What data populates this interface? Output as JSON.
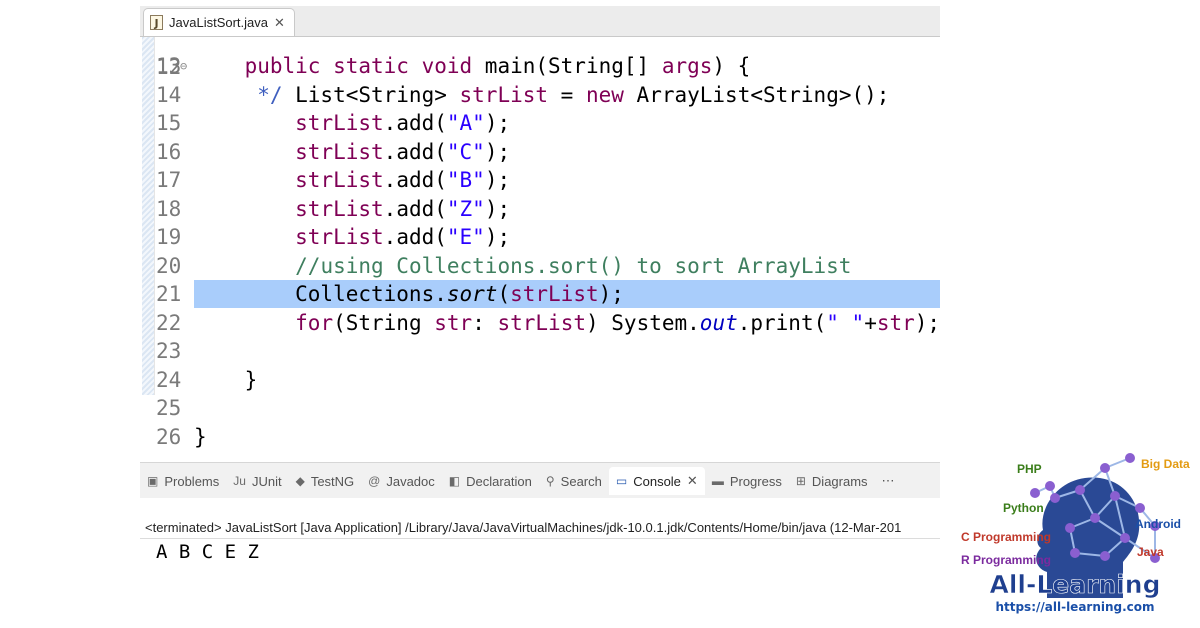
{
  "editor": {
    "tab": {
      "file_name": "JavaListSort.java",
      "close": "✕"
    },
    "top_fragment": {
      "line_number": "12",
      "code": "*/"
    },
    "lines": [
      {
        "n": "13",
        "fold": "⊖",
        "tokens": [
          {
            "t": "    "
          },
          {
            "t": "public static void",
            "c": "kw"
          },
          {
            "t": " main(String[] "
          },
          {
            "t": "args",
            "c": "kw"
          },
          {
            "t": ") {"
          }
        ]
      },
      {
        "n": "14",
        "tokens": [
          {
            "t": "        List<String> "
          },
          {
            "t": "strList",
            "c": "kw"
          },
          {
            "t": " = "
          },
          {
            "t": "new",
            "c": "kw"
          },
          {
            "t": " ArrayList<String>();"
          }
        ]
      },
      {
        "n": "15",
        "tokens": [
          {
            "t": "        "
          },
          {
            "t": "strList",
            "c": "kw"
          },
          {
            "t": ".add("
          },
          {
            "t": "\"A\"",
            "c": "str"
          },
          {
            "t": ");"
          }
        ]
      },
      {
        "n": "16",
        "tokens": [
          {
            "t": "        "
          },
          {
            "t": "strList",
            "c": "kw"
          },
          {
            "t": ".add("
          },
          {
            "t": "\"C\"",
            "c": "str"
          },
          {
            "t": ");"
          }
        ]
      },
      {
        "n": "17",
        "tokens": [
          {
            "t": "        "
          },
          {
            "t": "strList",
            "c": "kw"
          },
          {
            "t": ".add("
          },
          {
            "t": "\"B\"",
            "c": "str"
          },
          {
            "t": ");"
          }
        ]
      },
      {
        "n": "18",
        "tokens": [
          {
            "t": "        "
          },
          {
            "t": "strList",
            "c": "kw"
          },
          {
            "t": ".add("
          },
          {
            "t": "\"Z\"",
            "c": "str"
          },
          {
            "t": ");"
          }
        ]
      },
      {
        "n": "19",
        "tokens": [
          {
            "t": "        "
          },
          {
            "t": "strList",
            "c": "kw"
          },
          {
            "t": ".add("
          },
          {
            "t": "\"E\"",
            "c": "str"
          },
          {
            "t": ");"
          }
        ]
      },
      {
        "n": "20",
        "tokens": [
          {
            "t": "        "
          },
          {
            "t": "//using Collections.sort() to sort ArrayList",
            "c": "cm"
          }
        ]
      },
      {
        "n": "21",
        "tokens": [
          {
            "t": "        Collections."
          },
          {
            "t": "sort",
            "c": "it"
          },
          {
            "t": "("
          },
          {
            "t": "strList",
            "c": "kw"
          },
          {
            "t": ");"
          }
        ]
      },
      {
        "n": "22",
        "tokens": [
          {
            "t": "        "
          },
          {
            "t": "for",
            "c": "kw"
          },
          {
            "t": "(String "
          },
          {
            "t": "str",
            "c": "kw"
          },
          {
            "t": ": "
          },
          {
            "t": "strList",
            "c": "kw"
          },
          {
            "t": ") System."
          },
          {
            "t": "out",
            "c": "fld"
          },
          {
            "t": ".print("
          },
          {
            "t": "\" \"",
            "c": "str"
          },
          {
            "t": "+"
          },
          {
            "t": "str",
            "c": "kw"
          },
          {
            "t": ");"
          }
        ]
      },
      {
        "n": "23",
        "tokens": []
      },
      {
        "n": "24",
        "tokens": [
          {
            "t": "    }"
          }
        ]
      },
      {
        "n": "25",
        "tokens": []
      },
      {
        "n": "26",
        "tokens": [
          {
            "t": "}"
          }
        ]
      }
    ]
  },
  "views": {
    "tabs": [
      {
        "label": "Problems",
        "icon": "problems-icon",
        "glyph": "▣"
      },
      {
        "label": "JUnit",
        "icon": "junit-icon",
        "glyph": "Ju"
      },
      {
        "label": "TestNG",
        "icon": "testng-icon",
        "glyph": "◆"
      },
      {
        "label": "Javadoc",
        "icon": "javadoc-icon",
        "glyph": "@"
      },
      {
        "label": "Declaration",
        "icon": "declaration-icon",
        "glyph": "◧"
      },
      {
        "label": "Search",
        "icon": "search-icon",
        "glyph": "⚲"
      },
      {
        "label": "Console",
        "icon": "console-icon",
        "glyph": "▭",
        "active": true
      },
      {
        "label": "Progress",
        "icon": "progress-icon",
        "glyph": "▬"
      },
      {
        "label": "Diagrams",
        "icon": "diagrams-icon",
        "glyph": "⊞"
      }
    ],
    "console_close": "✕",
    "overflow_icon": "⋯"
  },
  "console": {
    "header": "<terminated> JavaListSort [Java Application] /Library/Java/JavaVirtualMachines/jdk-10.0.1.jdk/Contents/Home/bin/java (12-Mar-201",
    "output": "A B C E Z"
  },
  "logo": {
    "tags": [
      {
        "text": "PHP",
        "color": "#3a7d1a"
      },
      {
        "text": "Big Data",
        "color": "#e39b12"
      },
      {
        "text": "Python",
        "color": "#3a7d1a"
      },
      {
        "text": "Android",
        "color": "#1a4fa8"
      },
      {
        "text": "C Programming",
        "color": "#c0392b"
      },
      {
        "text": "Java",
        "color": "#c0392b"
      },
      {
        "text": "R Programming",
        "color": "#7b2a9e"
      }
    ],
    "brand": "All-Learning",
    "url": "https://all-learning.com",
    "colors": {
      "head": "#1f3f8f",
      "node": "#8a5fd0",
      "brand": "#1f3f8f",
      "url": "#1a4fa8"
    }
  }
}
